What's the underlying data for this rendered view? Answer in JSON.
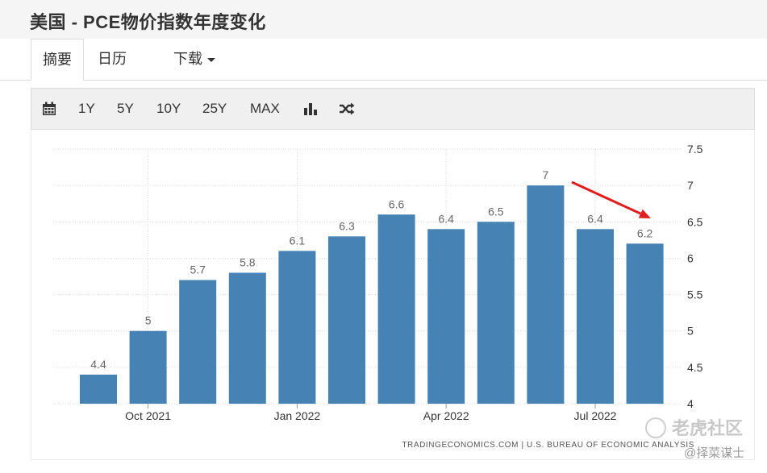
{
  "header": {
    "title": "美国 - PCE物价指数年度变化"
  },
  "tabs": [
    {
      "label": "摘要"
    },
    {
      "label": "日历"
    },
    {
      "label": "下载"
    }
  ],
  "toolbar": {
    "range_buttons": [
      "1Y",
      "5Y",
      "10Y",
      "25Y",
      "MAX"
    ],
    "icons": [
      "calendar-icon",
      "bar-chart-icon",
      "shuffle-icon"
    ]
  },
  "chart_data": {
    "type": "bar",
    "color": "#4682b4",
    "series": [
      {
        "values": [
          4.4,
          5,
          5.7,
          5.8,
          6.1,
          6.3,
          6.6,
          6.4,
          6.5,
          7,
          6.4,
          6.2
        ],
        "labels": [
          "4.4",
          "5",
          "5.7",
          "5.8",
          "6.1",
          "6.3",
          "6.6",
          "6.4",
          "6.5",
          "7",
          "6.4",
          "6.2"
        ]
      }
    ],
    "x_tick_labels": [
      {
        "index": 1,
        "label": "Oct 2021"
      },
      {
        "index": 4,
        "label": "Jan 2022"
      },
      {
        "index": 7,
        "label": "Apr 2022"
      },
      {
        "index": 10,
        "label": "Jul 2022"
      }
    ],
    "y_ticks": [
      "4",
      "4.5",
      "5",
      "5.5",
      "6",
      "6.5",
      "7",
      "7.5"
    ],
    "ylim": [
      4,
      7.5
    ],
    "y_axis_position": "right",
    "grid": true,
    "annotation": {
      "type": "arrow",
      "color": "#e02020"
    },
    "source": "TRADINGECONOMICS.COM | U.S. BUREAU OF ECONOMIC ANALYSIS"
  },
  "watermark": {
    "main": "老虎社区",
    "sub": "@择菜谋士"
  }
}
